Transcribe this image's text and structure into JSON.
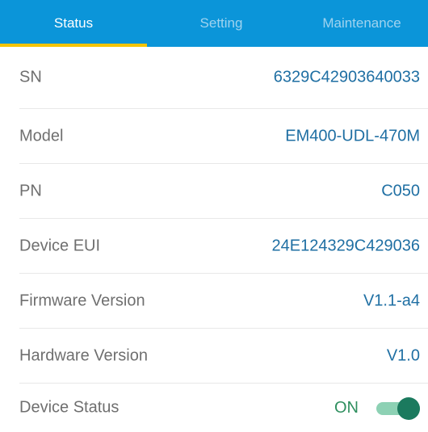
{
  "tabs": [
    {
      "label": "Status",
      "active": true
    },
    {
      "label": "Setting",
      "active": false
    },
    {
      "label": "Maintenance",
      "active": false
    }
  ],
  "colors": {
    "tabbar_bg": "#0b95d9",
    "active_tab_text": "#ffffff",
    "inactive_tab_text": "#9fd3ef",
    "underline": "#f5c400",
    "value_text": "#1f6fa3",
    "label_text": "#6f6f6f",
    "toggle_on": "#1b7a5e"
  },
  "rows": [
    {
      "label": "SN",
      "value": "6329C42903640033"
    },
    {
      "label": "Model",
      "value": "EM400-UDL-470M"
    },
    {
      "label": "PN",
      "value": "C050"
    },
    {
      "label": "Device EUI",
      "value": "24E124329C429036"
    },
    {
      "label": "Firmware Version",
      "value": "V1.1-a4"
    },
    {
      "label": "Hardware Version",
      "value": "V1.0"
    }
  ],
  "device_status": {
    "label": "Device Status",
    "value": "ON",
    "toggle_on": true
  }
}
